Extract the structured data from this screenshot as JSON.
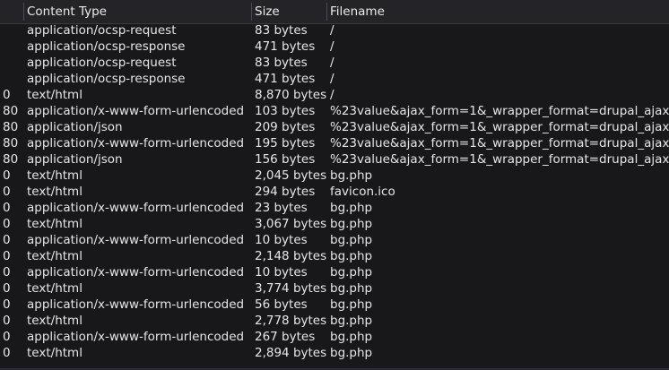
{
  "header": {
    "status": "",
    "content_type": "Content Type",
    "size": "Size",
    "filename": "Filename"
  },
  "rows": [
    {
      "status": "",
      "content_type": "application/ocsp-request",
      "size": "83 bytes",
      "filename": "/"
    },
    {
      "status": "",
      "content_type": "application/ocsp-response",
      "size": "471 bytes",
      "filename": "/"
    },
    {
      "status": "",
      "content_type": "application/ocsp-request",
      "size": "83 bytes",
      "filename": "/"
    },
    {
      "status": "",
      "content_type": "application/ocsp-response",
      "size": "471 bytes",
      "filename": "/"
    },
    {
      "status": "0",
      "content_type": "text/html",
      "size": "8,870 bytes",
      "filename": "/"
    },
    {
      "status": "80",
      "content_type": "application/x-www-form-urlencoded",
      "size": "103 bytes",
      "filename": "%23value&ajax_form=1&_wrapper_format=drupal_ajax"
    },
    {
      "status": "80",
      "content_type": "application/json",
      "size": "209 bytes",
      "filename": "%23value&ajax_form=1&_wrapper_format=drupal_ajax"
    },
    {
      "status": "80",
      "content_type": "application/x-www-form-urlencoded",
      "size": "195 bytes",
      "filename": "%23value&ajax_form=1&_wrapper_format=drupal_ajax"
    },
    {
      "status": "80",
      "content_type": "application/json",
      "size": "156 bytes",
      "filename": "%23value&ajax_form=1&_wrapper_format=drupal_ajax"
    },
    {
      "status": "0",
      "content_type": "text/html",
      "size": "2,045 bytes",
      "filename": "bg.php"
    },
    {
      "status": "0",
      "content_type": "text/html",
      "size": "294 bytes",
      "filename": "favicon.ico"
    },
    {
      "status": "0",
      "content_type": "application/x-www-form-urlencoded",
      "size": "23 bytes",
      "filename": "bg.php"
    },
    {
      "status": "0",
      "content_type": "text/html",
      "size": "3,067 bytes",
      "filename": "bg.php"
    },
    {
      "status": "0",
      "content_type": "application/x-www-form-urlencoded",
      "size": "10 bytes",
      "filename": "bg.php"
    },
    {
      "status": "0",
      "content_type": "text/html",
      "size": "2,148 bytes",
      "filename": "bg.php"
    },
    {
      "status": "0",
      "content_type": "application/x-www-form-urlencoded",
      "size": "10 bytes",
      "filename": "bg.php"
    },
    {
      "status": "0",
      "content_type": "text/html",
      "size": "3,774 bytes",
      "filename": "bg.php"
    },
    {
      "status": "0",
      "content_type": "application/x-www-form-urlencoded",
      "size": "56 bytes",
      "filename": "bg.php"
    },
    {
      "status": "0",
      "content_type": "text/html",
      "size": "2,778 bytes",
      "filename": "bg.php"
    },
    {
      "status": "0",
      "content_type": "application/x-www-form-urlencoded",
      "size": "267 bytes",
      "filename": "bg.php"
    },
    {
      "status": "0",
      "content_type": "text/html",
      "size": "2,894 bytes",
      "filename": "bg.php"
    }
  ]
}
